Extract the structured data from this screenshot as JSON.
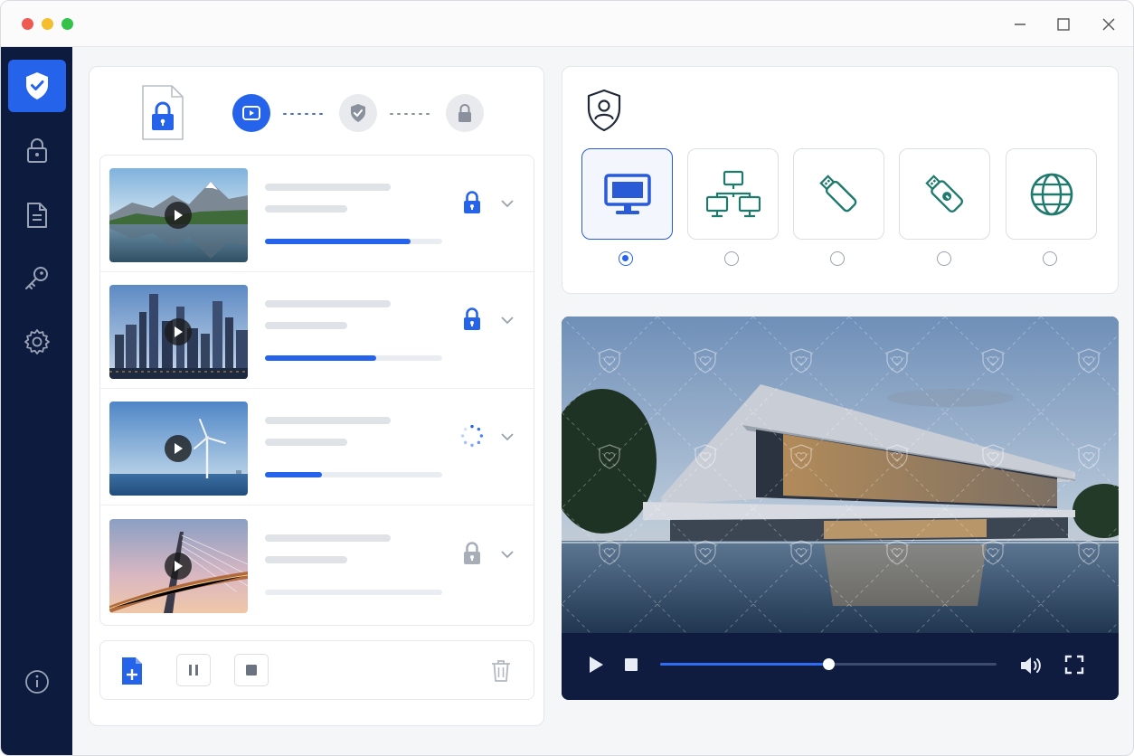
{
  "window": {
    "controls": [
      "minimize-icon",
      "maximize-icon",
      "close-icon"
    ]
  },
  "sidebar": {
    "items": [
      {
        "name": "shield-check",
        "active": true
      },
      {
        "name": "lock",
        "active": false
      },
      {
        "name": "document",
        "active": false
      },
      {
        "name": "key",
        "active": false
      },
      {
        "name": "gear",
        "active": false
      }
    ],
    "bottom_icon": "info-icon"
  },
  "steps": [
    "video-icon",
    "shield-icon",
    "lock-icon"
  ],
  "files": [
    {
      "thumbnail": "mountain-lake",
      "progress": 0.82,
      "status": "locked"
    },
    {
      "thumbnail": "city-skyline",
      "progress": 0.63,
      "status": "locked"
    },
    {
      "thumbnail": "wind-turbine",
      "progress": 0.32,
      "status": "processing"
    },
    {
      "thumbnail": "cable-bridge",
      "progress": 0,
      "status": "unlocked"
    }
  ],
  "actions": [
    "add-file-icon",
    "pause-icon",
    "stop-icon",
    "trash-icon"
  ],
  "targets": {
    "header_icon": "user-shield-icon",
    "options": [
      "monitor-icon",
      "network-icon",
      "usb-drive-icon",
      "secure-usb-icon",
      "globe-icon"
    ],
    "selected_index": 0
  },
  "player": {
    "video": "modern-building-at-dusk",
    "watermark": "shield-heart-watermark",
    "position": 0.5
  },
  "colors": {
    "accent": "#2563eb",
    "sidebar": "#0d1b3f",
    "device_icon": "#1f7a6e"
  }
}
